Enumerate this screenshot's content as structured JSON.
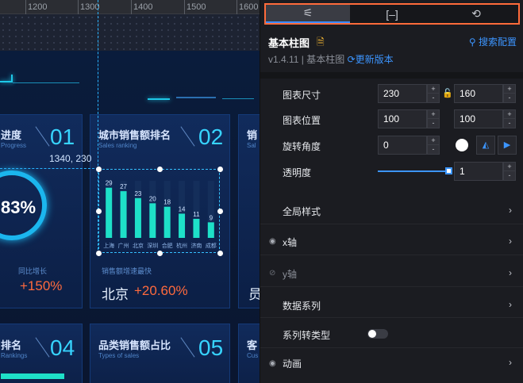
{
  "ruler": {
    "labels": [
      "1200",
      "1300",
      "1400",
      "1500",
      "1600"
    ]
  },
  "canvas": {
    "panels": [
      {
        "title": "进度",
        "subtitle": "Progress",
        "number": "01"
      },
      {
        "title": "城市销售额排名",
        "subtitle": "Sales ranking",
        "number": "02"
      },
      {
        "title": "销",
        "subtitle": "Sal",
        "number": ""
      },
      {
        "title": "排名",
        "subtitle": "Rankings",
        "number": "04"
      },
      {
        "title": "品类销售额占比",
        "subtitle": "Types of sales",
        "number": "05"
      },
      {
        "title": "客",
        "subtitle": "Cus",
        "number": ""
      }
    ],
    "ring_value": "83%",
    "stat1": {
      "label": "同比增长",
      "value": "+150%"
    },
    "stat2": {
      "label": "销售额增速最快",
      "city": "北京",
      "value": "+20.60%"
    },
    "stat3_fragment": "员",
    "coordinate": "1340, 230",
    "accent": "#37d4ff"
  },
  "chart_data": {
    "type": "bar",
    "categories": [
      "上海",
      "广州",
      "北京",
      "深圳",
      "合肥",
      "杭州",
      "济南",
      "成都"
    ],
    "values": [
      29,
      27,
      23,
      20,
      18,
      14,
      11,
      9
    ],
    "ylim": [
      0,
      33
    ],
    "bar_color": "#1ee0c8"
  },
  "config": {
    "tabs": [
      {
        "name": "settings",
        "glyph": "⚟",
        "active": true
      },
      {
        "name": "data",
        "glyph": "[–]",
        "active": false
      },
      {
        "name": "interaction",
        "glyph": "⟲",
        "active": false
      }
    ],
    "component_title": "基本柱图",
    "search_config": "搜索配置",
    "version": "v1.4.11 | 基本柱图",
    "update_link": "更新版本",
    "size": {
      "label": "图表尺寸",
      "width": "230",
      "height": "160"
    },
    "position": {
      "label": "图表位置",
      "x": "100",
      "y": "100"
    },
    "rotation": {
      "label": "旋转角度",
      "value": "0"
    },
    "opacity": {
      "label": "透明度",
      "value": "1",
      "level": 1
    },
    "sections": [
      {
        "label": "全局样式",
        "eye": false,
        "dim": false
      },
      {
        "label": "x轴",
        "eye": true,
        "dim": false
      },
      {
        "label": "y轴",
        "eye": true,
        "dim": true
      },
      {
        "label": "数据系列",
        "eye": false,
        "dim": false
      }
    ],
    "series_switch": {
      "label": "系列转类型",
      "on": false
    },
    "animation": {
      "label": "动画"
    }
  }
}
